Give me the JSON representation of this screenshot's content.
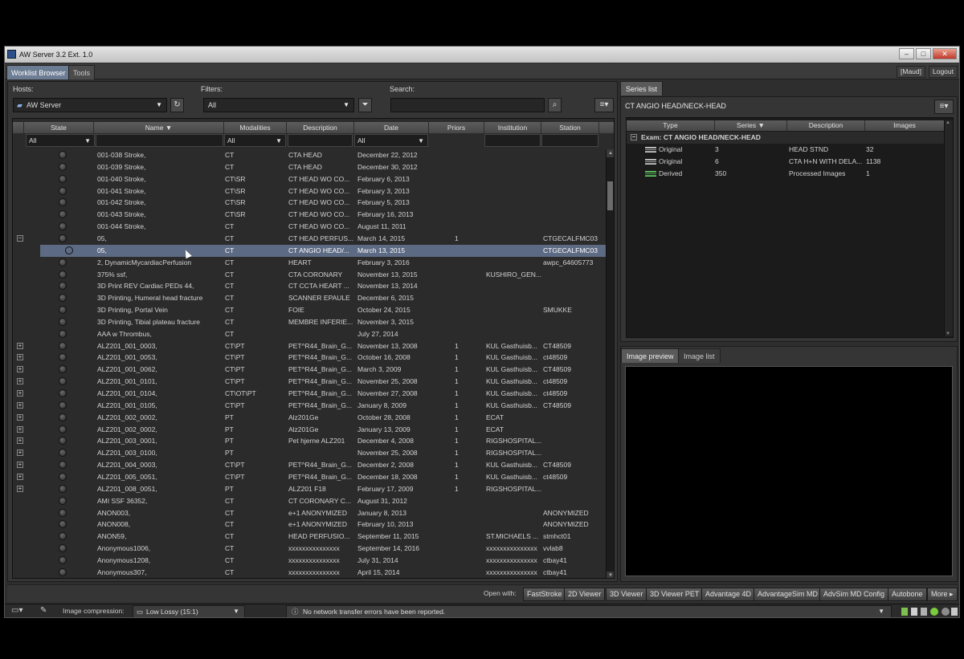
{
  "window": {
    "title": "AW Server 3.2 Ext. 1.0"
  },
  "tabs": [
    "Worklist Browser",
    "Tools"
  ],
  "user": {
    "name": "[Maud]",
    "logout_label": "Logout"
  },
  "controls": {
    "hosts_label": "Hosts:",
    "hosts_value": "AW Server",
    "filters_label": "Filters:",
    "filters_value": "All",
    "search_label": "Search:",
    "search_value": ""
  },
  "table": {
    "columns": [
      "State",
      "Name",
      "Modalities",
      "Description",
      "Date",
      "Priors",
      "Institution",
      "Station"
    ],
    "sort_column": "Name",
    "filters": {
      "state": "All",
      "modalities": "All",
      "date": "All"
    },
    "rows": [
      {
        "exp": "",
        "name": "001-038 Stroke,",
        "mod": "CT",
        "desc": "CTA HEAD",
        "date": "December 22, 2012",
        "priors": "",
        "inst": "",
        "station": ""
      },
      {
        "exp": "",
        "name": "001-039 Stroke,",
        "mod": "CT",
        "desc": "CTA HEAD",
        "date": "December 30, 2012",
        "priors": "",
        "inst": "",
        "station": ""
      },
      {
        "exp": "",
        "name": "001-040 Stroke,",
        "mod": "CT\\SR",
        "desc": "CT HEAD WO CO...",
        "date": "February 6, 2013",
        "priors": "",
        "inst": "",
        "station": ""
      },
      {
        "exp": "",
        "name": "001-041 Stroke,",
        "mod": "CT\\SR",
        "desc": "CT HEAD WO CO...",
        "date": "February 3, 2013",
        "priors": "",
        "inst": "",
        "station": ""
      },
      {
        "exp": "",
        "name": "001-042 Stroke,",
        "mod": "CT\\SR",
        "desc": "CT HEAD WO CO...",
        "date": "February 5, 2013",
        "priors": "",
        "inst": "",
        "station": ""
      },
      {
        "exp": "",
        "name": "001-043 Stroke,",
        "mod": "CT\\SR",
        "desc": "CT HEAD WO CO...",
        "date": "February 16, 2013",
        "priors": "",
        "inst": "",
        "station": ""
      },
      {
        "exp": "",
        "name": "001-044 Stroke,",
        "mod": "CT",
        "desc": "CT HEAD WO CO...",
        "date": "August 11, 2011",
        "priors": "",
        "inst": "",
        "station": ""
      },
      {
        "exp": "−",
        "name": "05,",
        "mod": "CT",
        "desc": "CT HEAD PERFUS...",
        "date": "March 14, 2015",
        "priors": "1",
        "inst": "",
        "station": "CTGECALFMC03"
      },
      {
        "exp": "",
        "name": "05,",
        "mod": "CT",
        "desc": "CT ANGIO HEAD/...",
        "date": "March 13, 2015",
        "priors": "",
        "inst": "",
        "station": "CTGECALFMC03",
        "selected": true
      },
      {
        "exp": "",
        "name": "2, DynamicMycardiacPerfusion",
        "mod": "CT",
        "desc": "HEART",
        "date": "February 3, 2016",
        "priors": "",
        "inst": "",
        "station": "awpc_64605773"
      },
      {
        "exp": "",
        "name": "375% ssf,",
        "mod": "CT",
        "desc": "CTA CORONARY",
        "date": "November 13, 2015",
        "priors": "",
        "inst": "KUSHIRO_GEN...",
        "station": ""
      },
      {
        "exp": "",
        "name": "3D Print REV Cardiac PEDs 44,",
        "mod": "CT",
        "desc": "CT CCTA HEART ...",
        "date": "November 13, 2014",
        "priors": "",
        "inst": "",
        "station": ""
      },
      {
        "exp": "",
        "name": "3D Printing, Humeral head fracture",
        "mod": "CT",
        "desc": "SCANNER EPAULE",
        "date": "December 6, 2015",
        "priors": "",
        "inst": "",
        "station": ""
      },
      {
        "exp": "",
        "name": "3D Printing, Portal Vein",
        "mod": "CT",
        "desc": "FOIE",
        "date": "October 24, 2015",
        "priors": "",
        "inst": "",
        "station": "SMUKKE"
      },
      {
        "exp": "",
        "name": "3D Printing, Tibial plateau fracture",
        "mod": "CT",
        "desc": "MEMBRE INFERIE...",
        "date": "November 3, 2015",
        "priors": "",
        "inst": "",
        "station": ""
      },
      {
        "exp": "",
        "name": "AAA w Thrombus,",
        "mod": "CT",
        "desc": "",
        "date": "July 27, 2014",
        "priors": "",
        "inst": "",
        "station": ""
      },
      {
        "exp": "+",
        "name": "ALZ201_001_0003,",
        "mod": "CT\\PT",
        "desc": "PET^R44_Brain_G...",
        "date": "November 13, 2008",
        "priors": "1",
        "inst": "KUL Gasthuisb...",
        "station": "CT48509"
      },
      {
        "exp": "+",
        "name": "ALZ201_001_0053,",
        "mod": "CT\\PT",
        "desc": "PET^R44_Brain_G...",
        "date": "October 16, 2008",
        "priors": "1",
        "inst": "KUL Gasthuisb...",
        "station": "ct48509"
      },
      {
        "exp": "+",
        "name": "ALZ201_001_0062,",
        "mod": "CT\\PT",
        "desc": "PET^R44_Brain_G...",
        "date": "March 3, 2009",
        "priors": "1",
        "inst": "KUL Gasthuisb...",
        "station": "CT48509"
      },
      {
        "exp": "+",
        "name": "ALZ201_001_0101,",
        "mod": "CT\\PT",
        "desc": "PET^R44_Brain_G...",
        "date": "November 25, 2008",
        "priors": "1",
        "inst": "KUL Gasthuisb...",
        "station": "ct48509"
      },
      {
        "exp": "+",
        "name": "ALZ201_001_0104,",
        "mod": "CT\\OT\\PT",
        "desc": "PET^R44_Brain_G...",
        "date": "November 27, 2008",
        "priors": "1",
        "inst": "KUL Gasthuisb...",
        "station": "ct48509"
      },
      {
        "exp": "+",
        "name": "ALZ201_001_0105,",
        "mod": "CT\\PT",
        "desc": "PET^R44_Brain_G...",
        "date": "January 8, 2009",
        "priors": "1",
        "inst": "KUL Gasthuisb...",
        "station": "CT48509"
      },
      {
        "exp": "+",
        "name": "ALZ201_002_0002,",
        "mod": "PT",
        "desc": "Alz201Ge",
        "date": "October 28, 2008",
        "priors": "1",
        "inst": "ECAT",
        "station": ""
      },
      {
        "exp": "+",
        "name": "ALZ201_002_0002,",
        "mod": "PT",
        "desc": "Alz201Ge",
        "date": "January 13, 2009",
        "priors": "1",
        "inst": "ECAT",
        "station": ""
      },
      {
        "exp": "+",
        "name": "ALZ201_003_0001,",
        "mod": "PT",
        "desc": "Pet hjerne ALZ201",
        "date": "December 4, 2008",
        "priors": "1",
        "inst": "RIGSHOSPITAL...",
        "station": ""
      },
      {
        "exp": "+",
        "name": "ALZ201_003_0100,",
        "mod": "PT",
        "desc": "",
        "date": "November 25, 2008",
        "priors": "1",
        "inst": "RIGSHOSPITAL...",
        "station": ""
      },
      {
        "exp": "+",
        "name": "ALZ201_004_0003,",
        "mod": "CT\\PT",
        "desc": "PET^R44_Brain_G...",
        "date": "December 2, 2008",
        "priors": "1",
        "inst": "KUL Gasthuisb...",
        "station": "CT48509"
      },
      {
        "exp": "+",
        "name": "ALZ201_005_0051,",
        "mod": "CT\\PT",
        "desc": "PET^R44_Brain_G...",
        "date": "December 18, 2008",
        "priors": "1",
        "inst": "KUL Gasthuisb...",
        "station": "ct48509"
      },
      {
        "exp": "+",
        "name": "ALZ201_008_0051,",
        "mod": "PT",
        "desc": "ALZ201 F18",
        "date": "February 17, 2009",
        "priors": "1",
        "inst": "RIGSHOSPITAL...",
        "station": ""
      },
      {
        "exp": "",
        "name": "AMI SSF 36352,",
        "mod": "CT",
        "desc": "CT  CORONARY C...",
        "date": "August 31, 2012",
        "priors": "",
        "inst": "",
        "station": ""
      },
      {
        "exp": "",
        "name": "ANON003,",
        "mod": "CT",
        "desc": "e+1 ANONYMIZED",
        "date": "January 8, 2013",
        "priors": "",
        "inst": "",
        "station": "ANONYMIZED"
      },
      {
        "exp": "",
        "name": "ANON008,",
        "mod": "CT",
        "desc": "e+1 ANONYMIZED",
        "date": "February 10, 2013",
        "priors": "",
        "inst": "",
        "station": "ANONYMIZED"
      },
      {
        "exp": "",
        "name": "ANON59,",
        "mod": "CT",
        "desc": "HEAD PERFUSIO...",
        "date": "September 11, 2015",
        "priors": "",
        "inst": "ST.MICHAELS ...",
        "station": "stmhct01"
      },
      {
        "exp": "",
        "name": "Anonymous1006,",
        "mod": "CT",
        "desc": "xxxxxxxxxxxxxxx",
        "date": "September 14, 2016",
        "priors": "",
        "inst": "xxxxxxxxxxxxxxx",
        "station": "vvlab8"
      },
      {
        "exp": "",
        "name": "Anonymous1208,",
        "mod": "CT",
        "desc": "xxxxxxxxxxxxxxx",
        "date": "July 31, 2014",
        "priors": "",
        "inst": "xxxxxxxxxxxxxxx",
        "station": "ctbay41"
      },
      {
        "exp": "",
        "name": "Anonymous307,",
        "mod": "CT",
        "desc": "xxxxxxxxxxxxxxx",
        "date": "April 15, 2014",
        "priors": "",
        "inst": "xxxxxxxxxxxxxxx",
        "station": "ctbay41"
      }
    ]
  },
  "series_list": {
    "tab_label": "Series list",
    "exam_title": "CT ANGIO HEAD/NECK-HEAD",
    "columns": [
      "Type",
      "Series",
      "Description",
      "Images"
    ],
    "group_label": "Exam: CT ANGIO HEAD/NECK-HEAD",
    "rows": [
      {
        "type": "Original",
        "series": "3",
        "desc": "HEAD STND",
        "images": "32"
      },
      {
        "type": "Original",
        "series": "6",
        "desc": "CTA H+N WITH DELA...",
        "images": "1138"
      },
      {
        "type": "Derived",
        "series": "350",
        "desc": "Processed Images",
        "images": "1"
      }
    ]
  },
  "preview_tabs": [
    "Image preview",
    "Image list"
  ],
  "open_with": {
    "label": "Open with:",
    "buttons": [
      "FastStroke",
      "2D Viewer",
      "3D Viewer",
      "3D Viewer PET",
      "Advantage 4D",
      "AdvantageSim MD",
      "AdvSim MD Config",
      "Autobone",
      "More ▸"
    ]
  },
  "status": {
    "compression_label": "Image compression:",
    "compression_value": "Low Lossy (15:1)",
    "network_message": "No network transfer errors have been reported."
  },
  "colors": {
    "selected_row": "#5d6a83",
    "active_tab": "#6c7c93",
    "close_button": "#c0392b"
  }
}
